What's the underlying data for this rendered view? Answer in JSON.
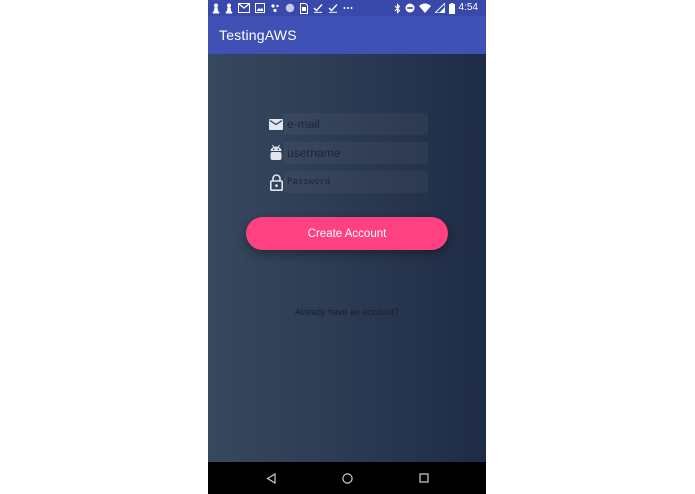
{
  "status_bar": {
    "time": "4:54",
    "left_icons": [
      "chess-pawn-icon",
      "chess-pawn-icon",
      "gmail-icon",
      "image-icon",
      "dots-icon",
      "circle-icon",
      "sim-icon",
      "check-icon",
      "check-icon",
      "more-icon"
    ],
    "right_icons": [
      "bluetooth-icon",
      "do-not-disturb-icon",
      "wifi-icon",
      "signal-icon",
      "battery-icon"
    ]
  },
  "app_bar": {
    "title": "TestingAWS",
    "color": "#3f51b5"
  },
  "form": {
    "email": {
      "placeholder": "e-mail",
      "icon": "email-icon"
    },
    "username": {
      "placeholder": "username",
      "icon": "android-icon"
    },
    "password": {
      "placeholder": "Password",
      "icon": "lock-icon"
    },
    "create_button_label": "Create Account",
    "button_color": "#ff4081",
    "signin_link": "Already have an account?"
  },
  "nav_bar": {
    "buttons": [
      "back-icon",
      "home-icon",
      "recents-icon"
    ]
  }
}
